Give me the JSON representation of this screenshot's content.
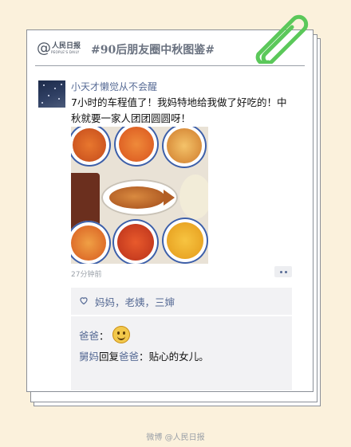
{
  "header": {
    "logo_mark": "@",
    "logo_text": "人民日报",
    "logo_subtext": "PEOPLE'S DAILY",
    "title": "#90后朋友圈中秋图鉴#"
  },
  "post": {
    "username": "小天才懒觉从不会醒",
    "content": "7小时的车程值了！我妈特地给我做了好吃的！中秋就要一家人团团圆圆呀！",
    "time": "27分钟前",
    "photo_icon": "food-photo",
    "likes": "妈妈，老姨，三婶",
    "comments": [
      {
        "author": "爸爸",
        "separator": "：",
        "emoji": "smile-emoji"
      },
      {
        "author": "舅妈",
        "reply_word": "回复",
        "reply_to": "爸爸",
        "separator": "：",
        "text": "贴心的女儿。"
      }
    ]
  },
  "footer": {
    "watermark": "微博 @人民日报"
  },
  "colors": {
    "background": "#fbf1dc",
    "link_blue": "#576b95",
    "clip_green": "#5bc85a",
    "border": "#8a8f97"
  }
}
